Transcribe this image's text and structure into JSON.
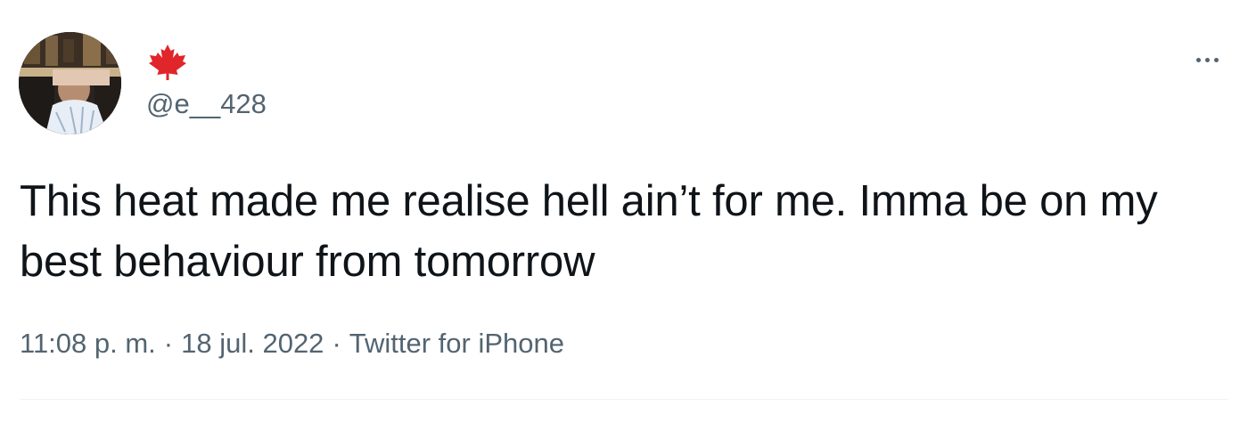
{
  "author": {
    "handle": "@e__428",
    "avatar_icon": "profile-photo",
    "flag_icon": "maple-leaf-icon",
    "flag_color": "#e0262a"
  },
  "tweet": {
    "text": "This heat made me realise hell ain’t for me. Imma be on my best behaviour from tomorrow",
    "time": "11:08 p. m.",
    "separator": "·",
    "date": "18 jul. 2022",
    "source": "Twitter for iPhone"
  },
  "colors": {
    "text": "#0f1419",
    "secondary": "#536471",
    "divider": "#eff3f4"
  }
}
